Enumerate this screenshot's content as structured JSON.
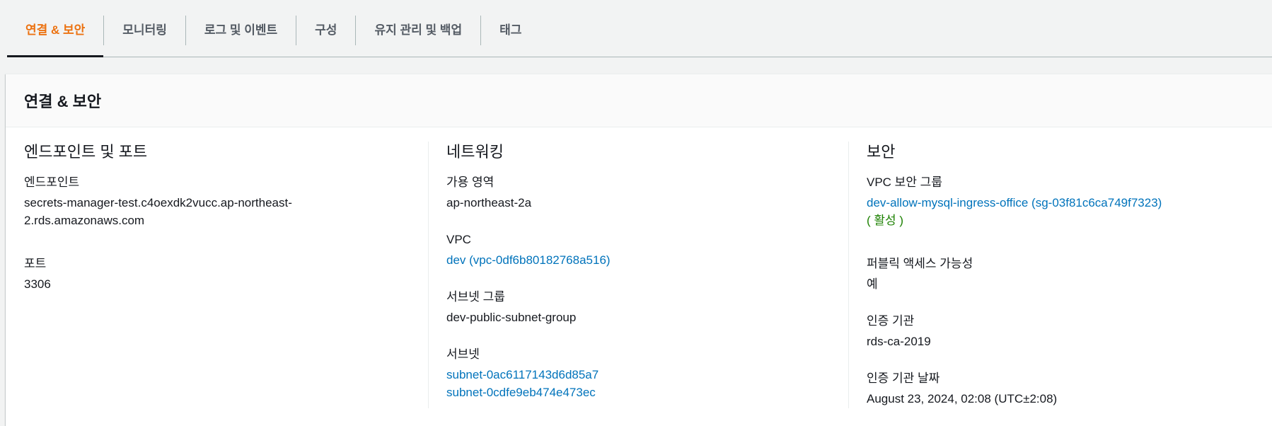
{
  "tabs": [
    {
      "label": "연결 & 보안",
      "active": true
    },
    {
      "label": "모니터링"
    },
    {
      "label": "로그 및 이벤트"
    },
    {
      "label": "구성"
    },
    {
      "label": "유지 관리 및 백업"
    },
    {
      "label": "태그"
    }
  ],
  "panel": {
    "title": "연결 & 보안"
  },
  "endpoint_section": {
    "title": "엔드포인트 및 포트",
    "endpoint_label": "엔드포인트",
    "endpoint_value_line1": "secrets-manager-test.c4oexdk2vucc.ap-northeast-",
    "endpoint_value_line2": "2.rds.amazonaws.com",
    "port_label": "포트",
    "port_value": "3306"
  },
  "networking_section": {
    "title": "네트워킹",
    "az_label": "가용 영역",
    "az_value": "ap-northeast-2a",
    "vpc_label": "VPC",
    "vpc_value": "dev (vpc-0df6b80182768a516)",
    "subnet_group_label": "서브넷 그룹",
    "subnet_group_value": "dev-public-subnet-group",
    "subnets_label": "서브넷",
    "subnets": [
      "subnet-0ac6117143d6d85a7",
      "subnet-0cdfe9eb474e473ec"
    ]
  },
  "security_section": {
    "title": "보안",
    "sg_label": "VPC 보안 그룹",
    "sg_value": "dev-allow-mysql-ingress-office (sg-03f81c6ca749f7323)",
    "sg_status": "( 활성 )",
    "public_access_label": "퍼블릭 액세스 가능성",
    "public_access_value": "예",
    "ca_label": "인증 기관",
    "ca_value": "rds-ca-2019",
    "ca_date_label": "인증 기관 날짜",
    "ca_date_value": "August 23, 2024, 02:08 (UTC±2:08)"
  },
  "colors": {
    "accent": "#ec7211",
    "link": "#0073bb",
    "status_active": "#1d8102"
  }
}
